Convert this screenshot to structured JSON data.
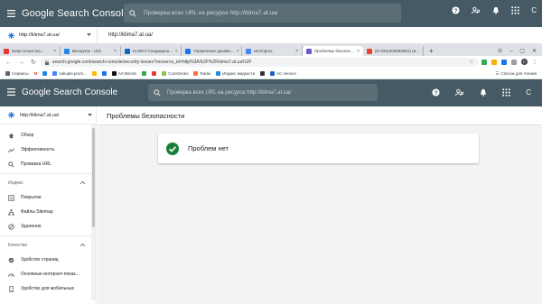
{
  "outer_header": {
    "brand": "Google Search Console",
    "search_placeholder": "Проверка всех URL на ресурсе http://klima7.at.ua/",
    "avatar_letter": "C"
  },
  "outer_property": {
    "selected": "http://klima7.at.ua/",
    "url": "http://klima7.at.ua/"
  },
  "tabs": [
    {
      "label": "Deep House Ба...",
      "color": "#e53935"
    },
    {
      "label": "Вкладчик - ULb",
      "color": "#1e88e5"
    },
    {
      "label": "KLIMA7 Кондицион...",
      "color": "#1565c0"
    },
    {
      "label": "Управление дизайн...",
      "color": "#1a73e8"
    },
    {
      "label": "uKompros",
      "color": "#4285f4"
    },
    {
      "label": "Проблемы безопас...",
      "color": "#6a5acd"
    },
    {
      "label": "(D-3311000083801) Ш...",
      "color": "#ea4335"
    }
  ],
  "address": {
    "url": "search.google.com/search-console/security-issues?resource_id=http%3A%2F%2Fklima7.at.ua%2F",
    "profile_letter": "C"
  },
  "bookmarks": {
    "items": [
      {
        "label": "Сервисы",
        "color": "#5f6368"
      },
      {
        "label": "M",
        "color": "#ea4335"
      },
      {
        "label": "",
        "color": "#1e88e5"
      },
      {
        "label": "zakupki.prom...",
        "color": "#4285f4"
      },
      {
        "label": "",
        "color": "#fbbc04"
      },
      {
        "label": "",
        "color": "#1a73e8"
      },
      {
        "label": "Art Blocks",
        "color": "#111111"
      },
      {
        "label": "",
        "color": "#34a853"
      },
      {
        "label": "",
        "color": "#e53935"
      },
      {
        "label": "CoinGecko",
        "color": "#8bc34a"
      },
      {
        "label": "Radio",
        "color": "#ff7043"
      },
      {
        "label": "Индекс жидкости",
        "color": "#1e88e5"
      },
      {
        "label": "",
        "color": "#333333"
      },
      {
        "label": "AC service",
        "color": "#1565c0"
      }
    ],
    "other": "Список для чтения"
  },
  "inner_header": {
    "brand": "Google Search Console",
    "search_placeholder": "Проверка всех URL на ресурсе http://klima7.at.ua/",
    "avatar_letter": "C"
  },
  "sidebar": {
    "property": "http://klima7.at.ua/",
    "items_top": [
      {
        "label": "Обзор",
        "icon": "home-icon"
      },
      {
        "label": "Эффективность",
        "icon": "trending-icon"
      },
      {
        "label": "Проверка URL",
        "icon": "search-icon"
      }
    ],
    "section_index": "Индекс",
    "items_index": [
      {
        "label": "Покрытие",
        "icon": "coverage-icon"
      },
      {
        "label": "Файлы Sitemap",
        "icon": "sitemap-icon"
      },
      {
        "label": "Удаления",
        "icon": "removals-icon"
      }
    ],
    "section_quality": "Качество",
    "items_quality": [
      {
        "label": "Удобство страниц",
        "icon": "page-experience-icon"
      },
      {
        "label": "Основные интернет-показ...",
        "icon": "web-vitals-icon"
      },
      {
        "label": "Удобство для мобильных",
        "icon": "mobile-icon"
      }
    ]
  },
  "main": {
    "title": "Проблемы безопасности",
    "status": "Проблем нет"
  },
  "colors": {
    "header_bg": "#455a64",
    "success_green": "#188038",
    "main_bg": "#f1f3f4"
  }
}
